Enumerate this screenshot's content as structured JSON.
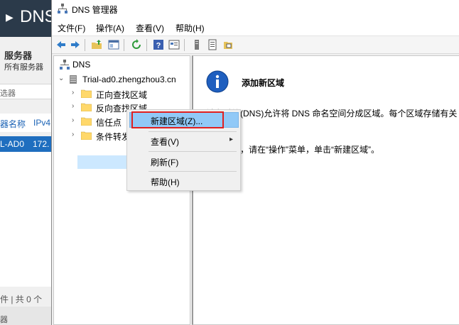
{
  "background_window": {
    "title": "DNS",
    "section_title": "服务器",
    "section_sub": "所有服务器",
    "filter_placeholder": "选器",
    "columns": [
      "器名称",
      "IPv4"
    ],
    "row": [
      "L-AD0",
      "172."
    ],
    "count_text": "件 | 共 0 个",
    "bottom_text": "器"
  },
  "window": {
    "title": "DNS 管理器"
  },
  "menubar": [
    {
      "label": "文件(F)"
    },
    {
      "label": "操作(A)"
    },
    {
      "label": "查看(V)"
    },
    {
      "label": "帮助(H)"
    }
  ],
  "toolbar": {
    "buttons": [
      "back-icon",
      "forward-icon",
      "up-folder-icon",
      "show-hide-tree-icon",
      "refresh-icon",
      "help-icon",
      "properties-icon",
      "server-icon",
      "records-icon",
      "zone-icon"
    ]
  },
  "tree": {
    "root": "DNS",
    "server": "Trial-ad0.zhengzhou3.cn",
    "children": [
      {
        "label": "正向查找区域"
      },
      {
        "label": "反向查找区域"
      },
      {
        "label": "信任点"
      },
      {
        "label": "条件转发器"
      }
    ]
  },
  "context_menu": {
    "items": [
      {
        "label": "新建区域(Z)..."
      },
      {
        "label": "查看(V)"
      },
      {
        "label": "刷新(F)"
      },
      {
        "label": "帮助(H)"
      }
    ]
  },
  "info": {
    "heading": "添加新区域",
    "p1": "域名系统(DNS)允许将 DNS 命名空间分成区域。每个区域存储有关",
    "p1b": "。",
    "p2": "个新区域，请在“操作”菜单，单击“新建区域”。"
  },
  "colors": {
    "selection": "#91c9f7",
    "highlight_outline": "#e02020",
    "tree_selected": "#cce8ff",
    "bg_header": "#2b3a4a"
  }
}
